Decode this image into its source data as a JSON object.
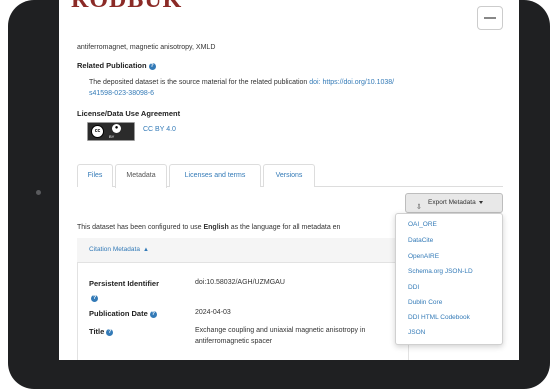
{
  "site": {
    "logo_text": "RODBUK"
  },
  "keywords_text": "antiferromagnet, magnetic anisotropy, XMLD",
  "related_publication": {
    "heading": "Related Publication",
    "text": "The deposited dataset is the source material for the related publication",
    "doi_line1": "doi: https://doi.org/10.1038/",
    "doi_line2": "s41598-023-38098-6"
  },
  "license": {
    "heading": "License/Data Use Agreement",
    "name": "CC BY 4.0",
    "badge_cc": "cc",
    "badge_by": "BY"
  },
  "tabs": [
    {
      "label": "Files"
    },
    {
      "label": "Metadata"
    },
    {
      "label": "Licenses and terms"
    },
    {
      "label": "Versions"
    }
  ],
  "export": {
    "button_label": "Export Metadata",
    "icon": "download-icon",
    "options": [
      "OAI_ORE",
      "DataCite",
      "OpenAIRE",
      "Schema.org JSON-LD",
      "DDI",
      "Dublin Core",
      "DDI HTML Codebook",
      "JSON"
    ]
  },
  "language_notice": {
    "pre": "This dataset has been configured to use ",
    "lang": "English",
    "post": " as the language for all metadata en"
  },
  "citation_metadata": {
    "header": "Citation Metadata",
    "fields": [
      {
        "label": "Persistent Identifier",
        "value": "doi:10.58032/AGH/UZMGAU"
      },
      {
        "label": "Publication Date",
        "value": "2024-04-03"
      },
      {
        "label": "Title",
        "value_line1": "Exchange coupling and uniaxial magnetic anisotropy in",
        "value_line2": "antiferromagnetic spacer"
      }
    ]
  },
  "colors": {
    "brand": "#8b2a26",
    "link": "#337ab7",
    "device": "#1f2022"
  }
}
